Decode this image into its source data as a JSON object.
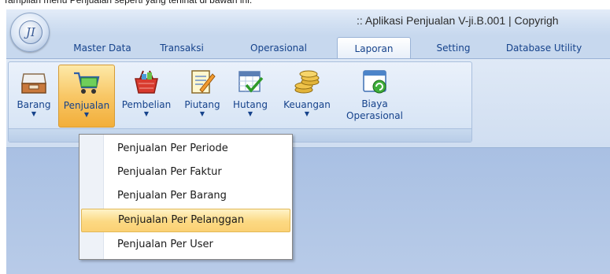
{
  "caption": "Tampilan menu Penjualan seperti yang terlihat di bawah ini:",
  "window": {
    "title": ":: Aplikasi Penjualan V-ji.B.001  |  Copyrigh",
    "logo_text": "JI"
  },
  "tabs": [
    {
      "label": "Master Data",
      "active": false
    },
    {
      "label": "Transaksi",
      "active": false
    },
    {
      "label": "Operasional",
      "active": false
    },
    {
      "label": "Laporan",
      "active": true
    },
    {
      "label": "Setting",
      "active": false
    },
    {
      "label": "Database Utility",
      "active": false
    }
  ],
  "ribbon": {
    "buttons": [
      {
        "label": "Barang",
        "icon": "inbox-tray-icon",
        "has_dropdown": true,
        "active": false
      },
      {
        "label": "Penjualan",
        "icon": "shopping-cart-icon",
        "has_dropdown": true,
        "active": true
      },
      {
        "label": "Pembelian",
        "icon": "shopping-basket-icon",
        "has_dropdown": true,
        "active": false
      },
      {
        "label": "Piutang",
        "icon": "notepad-pencil-icon",
        "has_dropdown": true,
        "active": false
      },
      {
        "label": "Hutang",
        "icon": "calendar-check-icon",
        "has_dropdown": true,
        "active": false
      },
      {
        "label": "Keuangan",
        "icon": "coin-stack-icon",
        "has_dropdown": true,
        "active": false
      },
      {
        "label": "Biaya Operasional",
        "label_line1": "Biaya",
        "label_line2": "Operasional",
        "icon": "window-refresh-icon",
        "has_dropdown": false,
        "active": false
      }
    ],
    "dropdown_glyph": "▼"
  },
  "dropdown_menu": {
    "items": [
      {
        "label": "Penjualan Per Periode",
        "highlighted": false
      },
      {
        "label": "Penjualan Per Faktur",
        "highlighted": false
      },
      {
        "label": "Penjualan Per Barang",
        "highlighted": false
      },
      {
        "label": "Penjualan Per Pelanggan",
        "highlighted": true
      },
      {
        "label": "Penjualan Per User",
        "highlighted": false
      }
    ]
  },
  "colors": {
    "ribbon_text": "#15428b",
    "highlight": "#fcd983",
    "client_area": "#a9c0e3"
  }
}
